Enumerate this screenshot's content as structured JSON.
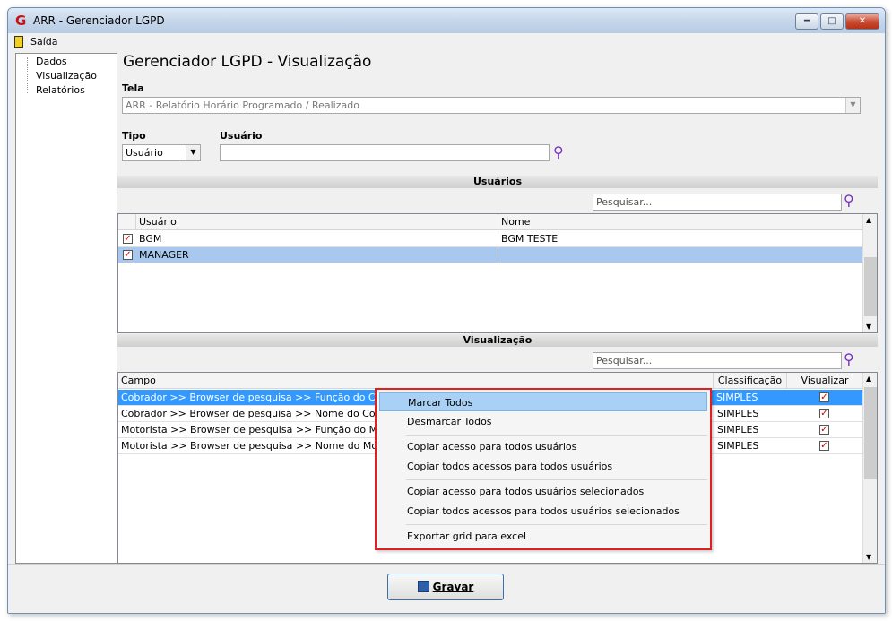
{
  "window": {
    "title": "ARR - Gerenciador LGPD"
  },
  "menu": {
    "exit_label": "Saída"
  },
  "tree": {
    "items": [
      "Dados",
      "Visualização",
      "Relatórios"
    ]
  },
  "page": {
    "title": "Gerenciador LGPD - Visualização",
    "tela_label": "Tela",
    "tela_value": "ARR - Relatório Horário Programado / Realizado",
    "tipo_label": "Tipo",
    "tipo_value": "Usuário",
    "usuario_label": "Usuário",
    "usuario_value": ""
  },
  "users_section": {
    "title": "Usuários",
    "search_placeholder": "Pesquisar...",
    "headers": [
      "Usuário",
      "Nome"
    ],
    "rows": [
      {
        "usuario": "BGM",
        "nome": "BGM TESTE",
        "checked": true
      },
      {
        "usuario": "MANAGER",
        "nome": "",
        "checked": true
      }
    ]
  },
  "view_section": {
    "title": "Visualização",
    "search_placeholder": "Pesquisar...",
    "headers": [
      "Campo",
      "Classificação",
      "Visualizar"
    ],
    "rows": [
      {
        "campo": "Cobrador >> Browser de pesquisa >> Função do Cobrador",
        "classificacao": "SIMPLES",
        "visualizar": true
      },
      {
        "campo": "Cobrador >> Browser de pesquisa >> Nome do Cobrador",
        "classificacao": "SIMPLES",
        "visualizar": true
      },
      {
        "campo": "Motorista >> Browser de pesquisa >> Função do Motorista",
        "classificacao": "SIMPLES",
        "visualizar": true
      },
      {
        "campo": "Motorista >> Browser de pesquisa >> Nome do Motorista",
        "classificacao": "SIMPLES",
        "visualizar": true
      }
    ]
  },
  "context_menu": {
    "items": [
      "Marcar Todos",
      "Desmarcar Todos",
      "Copiar acesso para todos usuários",
      "Copiar todos acessos para todos usuários",
      "Copiar acesso para todos usuários selecionados",
      "Copiar todos acessos para todos usuários selecionados",
      "Exportar grid para excel"
    ]
  },
  "footer": {
    "save_label": "Gravar"
  },
  "colors": {
    "selection": "#3399ff",
    "highlight_row": "#a9c8ef",
    "annotation_outline": "#e02020"
  }
}
